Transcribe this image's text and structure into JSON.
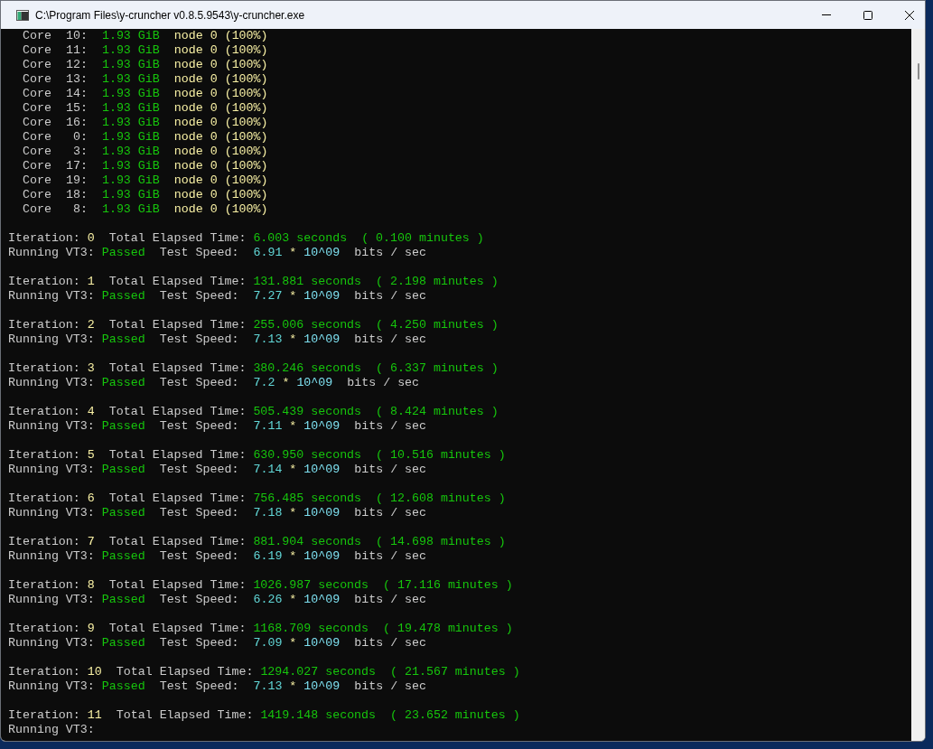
{
  "window": {
    "title": "C:\\Program Files\\y-cruncher v0.8.5.9543\\y-cruncher.exe"
  },
  "cores": [
    {
      "label": "Core",
      "number": "10:",
      "memory": "1.93 GiB",
      "node": "node 0",
      "share": "(100%)"
    },
    {
      "label": "Core",
      "number": "11:",
      "memory": "1.93 GiB",
      "node": "node 0",
      "share": "(100%)"
    },
    {
      "label": "Core",
      "number": "12:",
      "memory": "1.93 GiB",
      "node": "node 0",
      "share": "(100%)"
    },
    {
      "label": "Core",
      "number": "13:",
      "memory": "1.93 GiB",
      "node": "node 0",
      "share": "(100%)"
    },
    {
      "label": "Core",
      "number": "14:",
      "memory": "1.93 GiB",
      "node": "node 0",
      "share": "(100%)"
    },
    {
      "label": "Core",
      "number": "15:",
      "memory": "1.93 GiB",
      "node": "node 0",
      "share": "(100%)"
    },
    {
      "label": "Core",
      "number": "16:",
      "memory": "1.93 GiB",
      "node": "node 0",
      "share": "(100%)"
    },
    {
      "label": "Core",
      "number": "0:",
      "memory": "1.93 GiB",
      "node": "node 0",
      "share": "(100%)"
    },
    {
      "label": "Core",
      "number": "3:",
      "memory": "1.93 GiB",
      "node": "node 0",
      "share": "(100%)"
    },
    {
      "label": "Core",
      "number": "17:",
      "memory": "1.93 GiB",
      "node": "node 0",
      "share": "(100%)"
    },
    {
      "label": "Core",
      "number": "19:",
      "memory": "1.93 GiB",
      "node": "node 0",
      "share": "(100%)"
    },
    {
      "label": "Core",
      "number": "18:",
      "memory": "1.93 GiB",
      "node": "node 0",
      "share": "(100%)"
    },
    {
      "label": "Core",
      "number": "8:",
      "memory": "1.93 GiB",
      "node": "node 0",
      "share": "(100%)"
    }
  ],
  "iterations": [
    {
      "label": "Iteration:",
      "number": "0",
      "elapsed_label": "Total Elapsed Time:",
      "seconds": "6.003 seconds",
      "minutes": "( 0.100 minutes )",
      "test_label": "Running VT3:",
      "result": "Passed",
      "speed_label": "Test Speed:",
      "speed": "6.91",
      "times": "*",
      "exponent": "10^09",
      "unit": "bits / sec"
    },
    {
      "label": "Iteration:",
      "number": "1",
      "elapsed_label": "Total Elapsed Time:",
      "seconds": "131.881 seconds",
      "minutes": "( 2.198 minutes )",
      "test_label": "Running VT3:",
      "result": "Passed",
      "speed_label": "Test Speed:",
      "speed": "7.27",
      "times": "*",
      "exponent": "10^09",
      "unit": "bits / sec"
    },
    {
      "label": "Iteration:",
      "number": "2",
      "elapsed_label": "Total Elapsed Time:",
      "seconds": "255.006 seconds",
      "minutes": "( 4.250 minutes )",
      "test_label": "Running VT3:",
      "result": "Passed",
      "speed_label": "Test Speed:",
      "speed": "7.13",
      "times": "*",
      "exponent": "10^09",
      "unit": "bits / sec"
    },
    {
      "label": "Iteration:",
      "number": "3",
      "elapsed_label": "Total Elapsed Time:",
      "seconds": "380.246 seconds",
      "minutes": "( 6.337 minutes )",
      "test_label": "Running VT3:",
      "result": "Passed",
      "speed_label": "Test Speed:",
      "speed": "7.2",
      "times": "*",
      "exponent": "10^09",
      "unit": "bits / sec"
    },
    {
      "label": "Iteration:",
      "number": "4",
      "elapsed_label": "Total Elapsed Time:",
      "seconds": "505.439 seconds",
      "minutes": "( 8.424 minutes )",
      "test_label": "Running VT3:",
      "result": "Passed",
      "speed_label": "Test Speed:",
      "speed": "7.11",
      "times": "*",
      "exponent": "10^09",
      "unit": "bits / sec"
    },
    {
      "label": "Iteration:",
      "number": "5",
      "elapsed_label": "Total Elapsed Time:",
      "seconds": "630.950 seconds",
      "minutes": "( 10.516 minutes )",
      "test_label": "Running VT3:",
      "result": "Passed",
      "speed_label": "Test Speed:",
      "speed": "7.14",
      "times": "*",
      "exponent": "10^09",
      "unit": "bits / sec"
    },
    {
      "label": "Iteration:",
      "number": "6",
      "elapsed_label": "Total Elapsed Time:",
      "seconds": "756.485 seconds",
      "minutes": "( 12.608 minutes )",
      "test_label": "Running VT3:",
      "result": "Passed",
      "speed_label": "Test Speed:",
      "speed": "7.18",
      "times": "*",
      "exponent": "10^09",
      "unit": "bits / sec"
    },
    {
      "label": "Iteration:",
      "number": "7",
      "elapsed_label": "Total Elapsed Time:",
      "seconds": "881.904 seconds",
      "minutes": "( 14.698 minutes )",
      "test_label": "Running VT3:",
      "result": "Passed",
      "speed_label": "Test Speed:",
      "speed": "6.19",
      "times": "*",
      "exponent": "10^09",
      "unit": "bits / sec"
    },
    {
      "label": "Iteration:",
      "number": "8",
      "elapsed_label": "Total Elapsed Time:",
      "seconds": "1026.987 seconds",
      "minutes": "( 17.116 minutes )",
      "test_label": "Running VT3:",
      "result": "Passed",
      "speed_label": "Test Speed:",
      "speed": "6.26",
      "times": "*",
      "exponent": "10^09",
      "unit": "bits / sec"
    },
    {
      "label": "Iteration:",
      "number": "9",
      "elapsed_label": "Total Elapsed Time:",
      "seconds": "1168.709 seconds",
      "minutes": "( 19.478 minutes )",
      "test_label": "Running VT3:",
      "result": "Passed",
      "speed_label": "Test Speed:",
      "speed": "7.09",
      "times": "*",
      "exponent": "10^09",
      "unit": "bits / sec"
    },
    {
      "label": "Iteration:",
      "number": "10",
      "elapsed_label": "Total Elapsed Time:",
      "seconds": "1294.027 seconds",
      "minutes": "( 21.567 minutes )",
      "test_label": "Running VT3:",
      "result": "Passed",
      "speed_label": "Test Speed:",
      "speed": "7.13",
      "times": "*",
      "exponent": "10^09",
      "unit": "bits / sec"
    },
    {
      "label": "Iteration:",
      "number": "11",
      "elapsed_label": "Total Elapsed Time:",
      "seconds": "1419.148 seconds",
      "minutes": "( 23.652 minutes )",
      "test_label": "Running VT3:"
    }
  ]
}
